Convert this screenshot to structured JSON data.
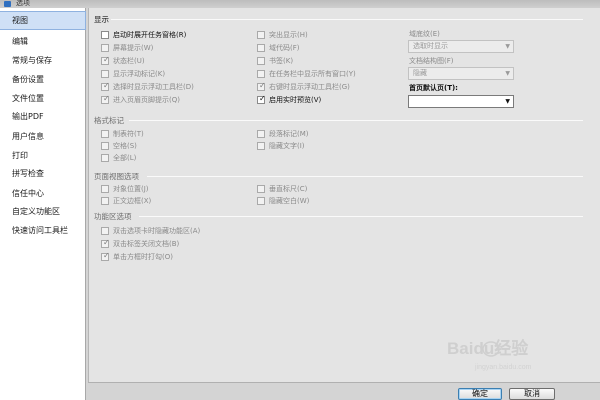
{
  "window": {
    "title": "选项"
  },
  "sidebar": {
    "items": [
      "视图",
      "编辑",
      "常规与保存",
      "备份设置",
      "文件位置",
      "输出PDF",
      "用户信息",
      "打印",
      "拼写检查",
      "信任中心",
      "自定义功能区",
      "快速访问工具栏"
    ]
  },
  "display": {
    "title": "显示",
    "left": [
      {
        "label": "启动时展开任务窗格(R)",
        "checked": false,
        "enabled": true
      },
      {
        "label": "屏幕提示(W)",
        "checked": false,
        "enabled": false
      },
      {
        "label": "状态栏(U)",
        "checked": true,
        "enabled": false
      },
      {
        "label": "显示浮动标记(K)",
        "checked": false,
        "enabled": false
      },
      {
        "label": "选择时显示浮动工具栏(D)",
        "checked": true,
        "enabled": false
      },
      {
        "label": "进入页眉页脚提示(Q)",
        "checked": true,
        "enabled": false
      }
    ],
    "mid": [
      {
        "label": "突出显示(H)",
        "checked": false,
        "enabled": false
      },
      {
        "label": "域代码(F)",
        "checked": false,
        "enabled": false
      },
      {
        "label": "书签(K)",
        "checked": false,
        "enabled": false
      },
      {
        "label": "在任务栏中显示所有窗口(Y)",
        "checked": false,
        "enabled": false
      },
      {
        "label": "右键时显示浮动工具栏(G)",
        "checked": true,
        "enabled": false
      },
      {
        "label": "启用实时预览(V)",
        "checked": true,
        "enabled": true
      }
    ],
    "shading_label": "域底纹(E)",
    "shading_value": "选取时显示",
    "docmap_label": "文档结构图(F)",
    "docmap_value": "隐藏",
    "default_page_label": "首页默认页(T):",
    "default_page_value": ""
  },
  "format_marks": {
    "title": "格式标记",
    "left": [
      {
        "label": "制表符(T)",
        "checked": false,
        "enabled": false
      },
      {
        "label": "空格(S)",
        "checked": false,
        "enabled": false
      },
      {
        "label": "全部(L)",
        "checked": false,
        "enabled": false
      }
    ],
    "mid": [
      {
        "label": "段落标记(M)",
        "checked": false,
        "enabled": false
      },
      {
        "label": "隐藏文字(I)",
        "checked": false,
        "enabled": false
      }
    ]
  },
  "page_view": {
    "title": "页面视图选项",
    "left": [
      {
        "label": "对象位置(J)",
        "checked": false,
        "enabled": false
      },
      {
        "label": "正文边框(X)",
        "checked": false,
        "enabled": false
      }
    ],
    "mid": [
      {
        "label": "垂直标尺(C)",
        "checked": false,
        "enabled": false
      },
      {
        "label": "隐藏空白(W)",
        "checked": false,
        "enabled": false
      }
    ]
  },
  "ribbon": {
    "title": "功能区选项",
    "items": [
      {
        "label": "双击选项卡时隐藏功能区(A)",
        "checked": false,
        "enabled": false
      },
      {
        "label": "双击标签关闭文档(B)",
        "checked": true,
        "enabled": false
      },
      {
        "label": "单击方框时打勾(O)",
        "checked": true,
        "enabled": false
      }
    ]
  },
  "buttons": {
    "ok": "确定",
    "cancel": "取消"
  },
  "watermark": {
    "text": "Baidu经验",
    "url": "jingyan.baidu.com"
  },
  "colors": {
    "sidebar_selected": "#cfe0f6",
    "panel_bg": "#e4e4e4",
    "accent": "#3c7fb1",
    "watermark": "#cfcfcf"
  }
}
